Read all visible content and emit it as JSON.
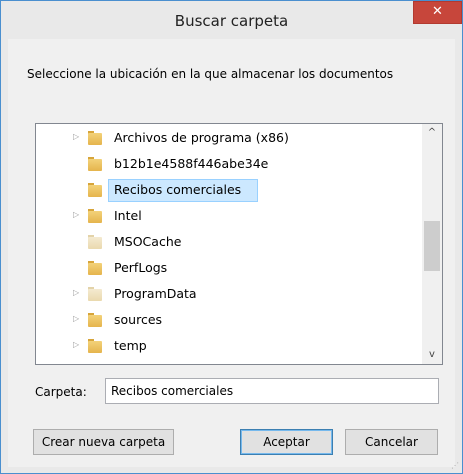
{
  "window": {
    "title": "Buscar carpeta",
    "close_glyph": "✕"
  },
  "instruction": "Seleccione la ubicación en la que almacenar los documentos",
  "tree": {
    "items": [
      {
        "label": "Archivos de programa (x86)",
        "expandable": true,
        "pale": false,
        "selected": false
      },
      {
        "label": "b12b1e4588f446abe34e",
        "expandable": false,
        "pale": false,
        "selected": false
      },
      {
        "label": "Recibos comerciales",
        "expandable": false,
        "pale": false,
        "selected": true
      },
      {
        "label": "Intel",
        "expandable": true,
        "pale": false,
        "selected": false
      },
      {
        "label": "MSOCache",
        "expandable": false,
        "pale": true,
        "selected": false
      },
      {
        "label": "PerfLogs",
        "expandable": false,
        "pale": false,
        "selected": false
      },
      {
        "label": "ProgramData",
        "expandable": true,
        "pale": true,
        "selected": false
      },
      {
        "label": "sources",
        "expandable": true,
        "pale": false,
        "selected": false
      },
      {
        "label": "temp",
        "expandable": true,
        "pale": false,
        "selected": false
      }
    ],
    "scroll_up_glyph": "^",
    "scroll_down_glyph": "v",
    "expand_glyph": "▷"
  },
  "folder_field": {
    "label": "Carpeta:",
    "value": "Recibos comerciales"
  },
  "buttons": {
    "new_folder": "Crear nueva carpeta",
    "ok": "Aceptar",
    "cancel": "Cancelar"
  },
  "colors": {
    "close_button": "#c7463b",
    "selection": "#cce8ff",
    "folder": "#e5b44c"
  }
}
